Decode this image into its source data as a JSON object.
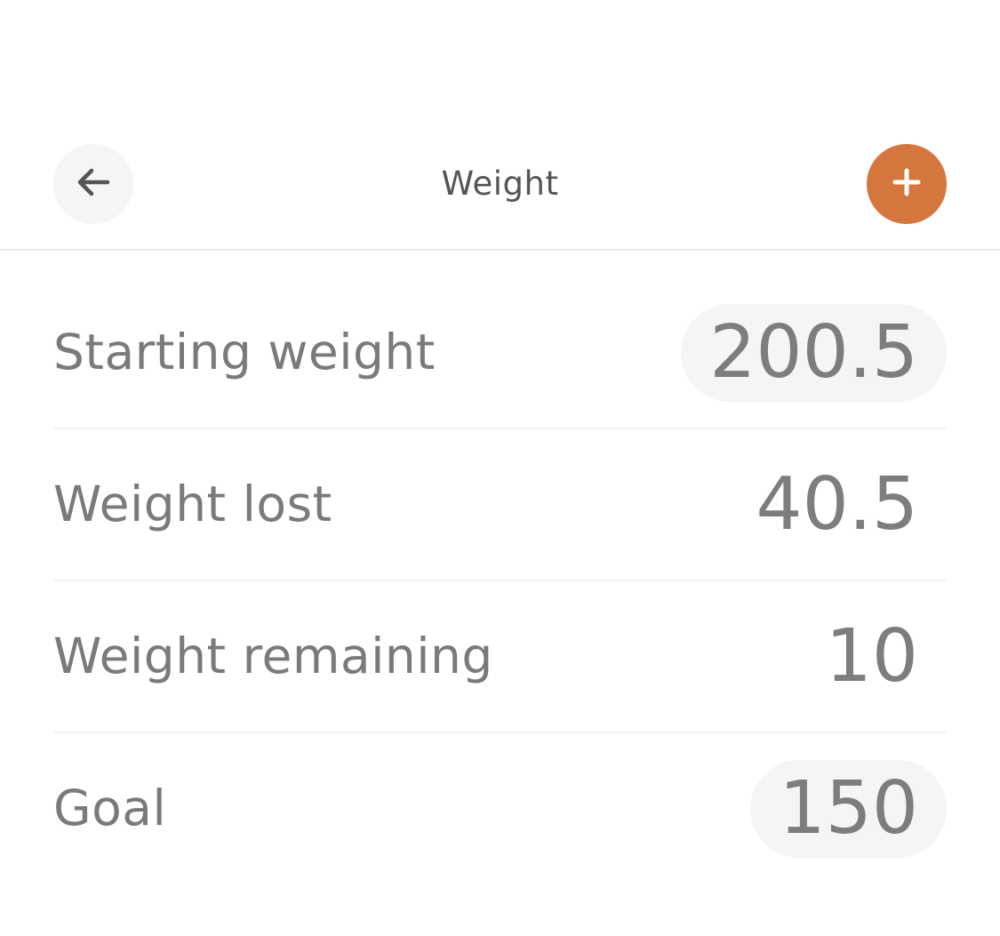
{
  "colors": {
    "accent": "#d6763f",
    "pill_background": "#f5f5f5",
    "text": "#7a7a7a"
  },
  "header": {
    "title": "Weight",
    "back_icon": "arrow-left-icon",
    "add_icon": "plus-icon"
  },
  "stats": [
    {
      "label": "Starting weight",
      "value": "200.5",
      "editable": true
    },
    {
      "label": "Weight lost",
      "value": "40.5",
      "editable": false
    },
    {
      "label": "Weight remaining",
      "value": "10",
      "editable": false
    },
    {
      "label": "Goal",
      "value": "150",
      "editable": true
    }
  ]
}
